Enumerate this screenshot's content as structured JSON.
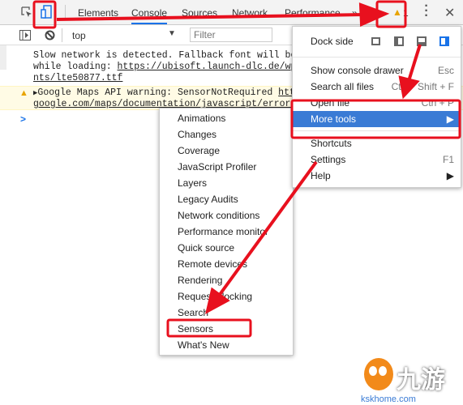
{
  "toolbar": {
    "tabs": [
      "Elements",
      "Console",
      "Sources",
      "Network",
      "Performance"
    ],
    "more": "»",
    "warning_count": "1"
  },
  "console_bar": {
    "context": "top",
    "filter_placeholder": "Filter"
  },
  "messages": [
    {
      "lines": [
        "Slow network is detected. Fallback font will be",
        "while loading: "
      ],
      "link1": "https://ubisoft.launch-dlc.de/wp-",
      "link2": "nts/lte50877.ttf"
    },
    {
      "text": "Google Maps API warning: SensorNotRequired ",
      "link1": "http",
      "link2": "google.com/maps/documentation/javascript/error-m"
    }
  ],
  "prompt": ">",
  "main_menu": {
    "dock_side": "Dock side",
    "items": [
      {
        "label": "Show console drawer",
        "shortcut": "Esc"
      },
      {
        "label": "Search all files",
        "shortcut": "Ctrl + Shift + F"
      },
      {
        "label": "Open file",
        "shortcut": "Ctrl + P"
      },
      {
        "label": "More tools",
        "shortcut": "▶"
      },
      {
        "label": "Shortcuts",
        "shortcut": ""
      },
      {
        "label": "Settings",
        "shortcut": "F1"
      },
      {
        "label": "Help",
        "shortcut": "▶"
      }
    ]
  },
  "submenu": {
    "items": [
      "Animations",
      "Changes",
      "Coverage",
      "JavaScript Profiler",
      "Layers",
      "Legacy Audits",
      "Network conditions",
      "Performance monitor",
      "Quick source",
      "Remote devices",
      "Rendering",
      "Request blocking",
      "Search",
      "Sensors",
      "What's New"
    ]
  },
  "colors": {
    "annotation": "#e8101e",
    "highlight": "#3a7bd5",
    "accent": "#1a73e8"
  },
  "watermark": {
    "logo": "九游",
    "site": "kskhome.com"
  }
}
